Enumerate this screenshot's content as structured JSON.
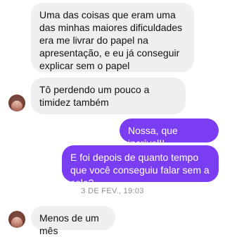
{
  "messages": [
    {
      "id": "m1",
      "direction": "incoming",
      "text": "Uma das coisas que eram uma das minhas maiores dificuldades era me livrar do papel na apresentação, e eu já conseguir explicar sem o papel"
    },
    {
      "id": "m2",
      "direction": "incoming",
      "text": "Tô perdendo um pouco a timidez também"
    },
    {
      "id": "m3",
      "direction": "outgoing",
      "text": "Nossa, que incrível!!"
    },
    {
      "id": "m4",
      "direction": "outgoing",
      "text": "E foi depois de quanto tempo que você conseguiu falar sem a cola?"
    },
    {
      "id": "m5",
      "direction": "incoming",
      "text": "Menos de um mês"
    }
  ],
  "timestamp": "3 DE FEV., 19:03",
  "colors": {
    "incoming_bg": "#efeff1",
    "outgoing_bg": "#7b3df2",
    "timestamp_text": "#8e8e93"
  },
  "icons": {
    "avatar": "contact-avatar-photo"
  }
}
